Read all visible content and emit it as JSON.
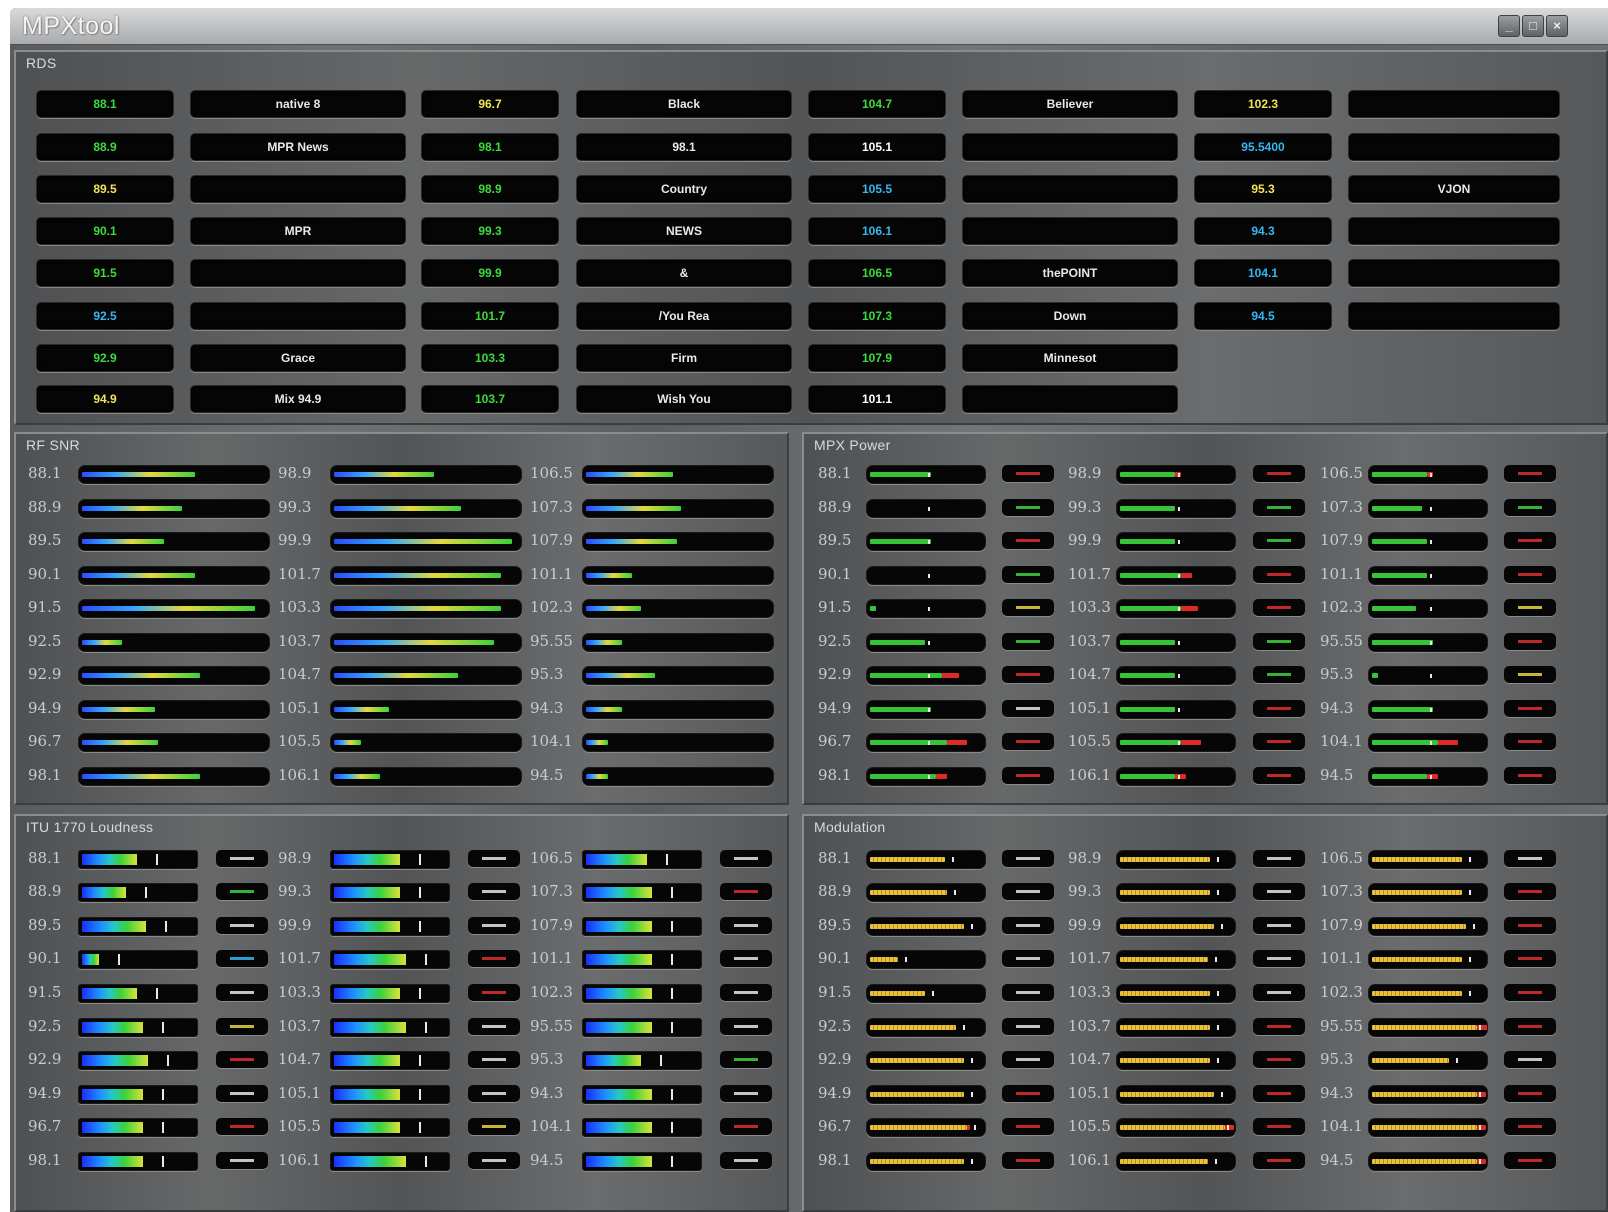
{
  "window": {
    "title": "MPXtool"
  },
  "rds": {
    "title": "RDS",
    "columns": [
      {
        "freqs": [
          "88.1",
          "88.9",
          "89.5",
          "90.1",
          "91.5",
          "92.5",
          "92.9",
          "94.9"
        ],
        "freq_colors": [
          "#3ddc3d",
          "#3ddc3d",
          "#f1e35a",
          "#3ddc3d",
          "#3ddc3d",
          "#36b7f0",
          "#3ddc3d",
          "#f1e35a"
        ],
        "names": [
          "native 8",
          "MPR News",
          "",
          "MPR",
          "",
          "",
          "Grace",
          "Mix 94.9"
        ]
      },
      {
        "freqs": [
          "96.7",
          "98.1",
          "98.9",
          "99.3",
          "99.9",
          "101.7",
          "103.3",
          "103.7"
        ],
        "freq_colors": [
          "#f1e35a",
          "#3ddc3d",
          "#3ddc3d",
          "#3ddc3d",
          "#3ddc3d",
          "#3ddc3d",
          "#3ddc3d",
          "#3ddc3d"
        ],
        "names": [
          "Black",
          "98.1",
          "Country",
          "NEWS",
          "&",
          "/You Rea",
          "Firm",
          "Wish You"
        ]
      },
      {
        "freqs": [
          "104.7",
          "105.1",
          "105.5",
          "106.1",
          "106.5",
          "107.3",
          "107.9",
          "101.1"
        ],
        "freq_colors": [
          "#3ddc3d",
          "#ffffff",
          "#36b7f0",
          "#36b7f0",
          "#3ddc3d",
          "#3ddc3d",
          "#3ddc3d",
          "#ffffff"
        ],
        "names": [
          "Believer",
          "",
          "",
          "",
          "thePOINT",
          "Down",
          "Minnesot",
          ""
        ]
      },
      {
        "freqs": [
          "102.3",
          "95.5400",
          "95.3",
          "94.3",
          "104.1",
          "94.5"
        ],
        "freq_colors": [
          "#f1e35a",
          "#36b7f0",
          "#f1e35a",
          "#36b7f0",
          "#36b7f0",
          "#36b7f0"
        ],
        "names": [
          "",
          "",
          "VJON",
          "",
          "",
          ""
        ]
      }
    ]
  },
  "rf_snr": {
    "title": "RF SNR",
    "columns": [
      {
        "labels": [
          "88.1",
          "88.9",
          "89.5",
          "90.1",
          "91.5",
          "92.5",
          "92.9",
          "94.9",
          "96.7",
          "98.1"
        ],
        "levels": [
          0.62,
          0.55,
          0.45,
          0.62,
          0.95,
          0.22,
          0.65,
          0.4,
          0.42,
          0.65
        ]
      },
      {
        "labels": [
          "98.9",
          "99.3",
          "99.9",
          "101.7",
          "103.3",
          "103.7",
          "104.7",
          "105.1",
          "105.5",
          "106.1"
        ],
        "levels": [
          0.55,
          0.7,
          0.98,
          0.92,
          0.92,
          0.88,
          0.68,
          0.3,
          0.15,
          0.25
        ]
      },
      {
        "labels": [
          "106.5",
          "107.3",
          "107.9",
          "101.1",
          "102.3",
          "95.55",
          "95.3",
          "94.3",
          "104.1",
          "94.5"
        ],
        "levels": [
          0.48,
          0.52,
          0.5,
          0.25,
          0.3,
          0.2,
          0.38,
          0.2,
          0.12,
          0.12
        ]
      }
    ]
  },
  "mpx_power": {
    "title": "MPX Power",
    "columns": [
      {
        "labels": [
          "88.1",
          "88.9",
          "89.5",
          "90.1",
          "91.5",
          "92.5",
          "92.9",
          "94.9",
          "96.7",
          "98.1"
        ],
        "levels": [
          0.55,
          0.0,
          0.55,
          0.0,
          0.05,
          0.5,
          0.65,
          0.55,
          0.7,
          0.6
        ],
        "red": [
          0.0,
          0.0,
          0.0,
          0.0,
          0.0,
          0.0,
          0.15,
          0.0,
          0.18,
          0.1
        ],
        "value_colors": [
          "#e23030",
          "#3fcf3f",
          "#e23030",
          "#3fcf3f",
          "#e8d642",
          "#3fcf3f",
          "#e23030",
          "#e8e8e8",
          "#e23030",
          "#e23030"
        ]
      },
      {
        "labels": [
          "98.9",
          "99.3",
          "99.9",
          "101.7",
          "103.3",
          "103.7",
          "104.7",
          "105.1",
          "105.5",
          "106.1"
        ],
        "levels": [
          0.5,
          0.5,
          0.5,
          0.55,
          0.55,
          0.5,
          0.5,
          0.5,
          0.55,
          0.5
        ],
        "red": [
          0.05,
          0.0,
          0.0,
          0.1,
          0.15,
          0.0,
          0.0,
          0.0,
          0.18,
          0.1
        ],
        "value_colors": [
          "#e23030",
          "#3fcf3f",
          "#3fcf3f",
          "#e23030",
          "#e23030",
          "#3fcf3f",
          "#3fcf3f",
          "#e23030",
          "#e23030",
          "#e23030"
        ]
      },
      {
        "labels": [
          "106.5",
          "107.3",
          "107.9",
          "101.1",
          "102.3",
          "95.55",
          "95.3",
          "94.3",
          "104.1",
          "94.5"
        ],
        "levels": [
          0.5,
          0.45,
          0.5,
          0.5,
          0.4,
          0.55,
          0.05,
          0.55,
          0.6,
          0.5
        ],
        "red": [
          0.05,
          0.0,
          0.0,
          0.0,
          0.0,
          0.0,
          0.0,
          0.0,
          0.18,
          0.1
        ],
        "value_colors": [
          "#e23030",
          "#3fcf3f",
          "#e23030",
          "#e23030",
          "#e8d642",
          "#e23030",
          "#e8d642",
          "#e23030",
          "#e23030",
          "#e23030"
        ]
      }
    ]
  },
  "loudness": {
    "title": "ITU 1770 Loudness",
    "columns": [
      {
        "labels": [
          "88.1",
          "88.9",
          "89.5",
          "90.1",
          "91.5",
          "92.5",
          "92.9",
          "94.9",
          "96.7",
          "98.1"
        ],
        "levels": [
          0.5,
          0.4,
          0.58,
          0.15,
          0.5,
          0.55,
          0.6,
          0.55,
          0.55,
          0.55
        ],
        "value_colors": [
          "#e8e8e8",
          "#3fcf3f",
          "#e8e8e8",
          "#36b7f0",
          "#e8e8e8",
          "#e8d642",
          "#e23030",
          "#e8e8e8",
          "#e23030",
          "#e8e8e8"
        ]
      },
      {
        "labels": [
          "98.9",
          "99.3",
          "99.9",
          "101.7",
          "103.3",
          "103.7",
          "104.7",
          "105.1",
          "105.5",
          "106.1"
        ],
        "levels": [
          0.6,
          0.6,
          0.6,
          0.65,
          0.6,
          0.65,
          0.6,
          0.6,
          0.6,
          0.65
        ],
        "value_colors": [
          "#e8e8e8",
          "#e8e8e8",
          "#e8e8e8",
          "#e23030",
          "#e23030",
          "#e8e8e8",
          "#e8e8e8",
          "#e8e8e8",
          "#e8d642",
          "#e8e8e8"
        ]
      },
      {
        "labels": [
          "106.5",
          "107.3",
          "107.9",
          "101.1",
          "102.3",
          "95.55",
          "95.3",
          "94.3",
          "104.1",
          "94.5"
        ],
        "levels": [
          0.55,
          0.6,
          0.6,
          0.6,
          0.6,
          0.6,
          0.5,
          0.6,
          0.6,
          0.6
        ],
        "value_colors": [
          "#e8e8e8",
          "#e23030",
          "#e8e8e8",
          "#e8e8e8",
          "#e8e8e8",
          "#e8e8e8",
          "#3fcf3f",
          "#e8e8e8",
          "#e23030",
          "#e8e8e8"
        ]
      }
    ]
  },
  "modulation": {
    "title": "Modulation",
    "columns": [
      {
        "labels": [
          "88.1",
          "88.9",
          "89.5",
          "90.1",
          "91.5",
          "92.5",
          "92.9",
          "94.9",
          "96.7",
          "98.1"
        ],
        "levels": [
          0.68,
          0.7,
          0.85,
          0.25,
          0.5,
          0.78,
          0.85,
          0.85,
          0.88,
          0.85
        ],
        "red": [
          0,
          0,
          0,
          0,
          0,
          0,
          0,
          0,
          0.03,
          0
        ],
        "value_colors": [
          "#e8e8e8",
          "#e8e8e8",
          "#e8e8e8",
          "#e8e8e8",
          "#e8e8e8",
          "#e8e8e8",
          "#e8e8e8",
          "#e23030",
          "#e23030",
          "#e23030"
        ]
      },
      {
        "labels": [
          "98.9",
          "99.3",
          "99.9",
          "101.7",
          "103.3",
          "103.7",
          "104.7",
          "105.1",
          "105.5",
          "106.1"
        ],
        "levels": [
          0.82,
          0.82,
          0.85,
          0.8,
          0.82,
          0.82,
          0.82,
          0.85,
          0.95,
          0.8
        ],
        "red": [
          0,
          0,
          0,
          0,
          0,
          0,
          0,
          0,
          0.08,
          0
        ],
        "value_colors": [
          "#e8e8e8",
          "#e8e8e8",
          "#e8e8e8",
          "#e8e8e8",
          "#e8e8e8",
          "#e23030",
          "#e23030",
          "#e23030",
          "#e23030",
          "#e23030"
        ]
      },
      {
        "labels": [
          "106.5",
          "107.3",
          "107.9",
          "101.1",
          "102.3",
          "95.55",
          "95.3",
          "94.3",
          "104.1",
          "94.5"
        ],
        "levels": [
          0.82,
          0.82,
          0.85,
          0.82,
          0.82,
          0.95,
          0.7,
          0.95,
          0.95,
          0.95
        ],
        "red": [
          0,
          0,
          0,
          0,
          0,
          0.1,
          0,
          0.08,
          0.08,
          0.08
        ],
        "value_colors": [
          "#e8e8e8",
          "#e23030",
          "#e23030",
          "#e23030",
          "#e23030",
          "#e23030",
          "#e8e8e8",
          "#e23030",
          "#e23030",
          "#e23030"
        ]
      }
    ]
  }
}
